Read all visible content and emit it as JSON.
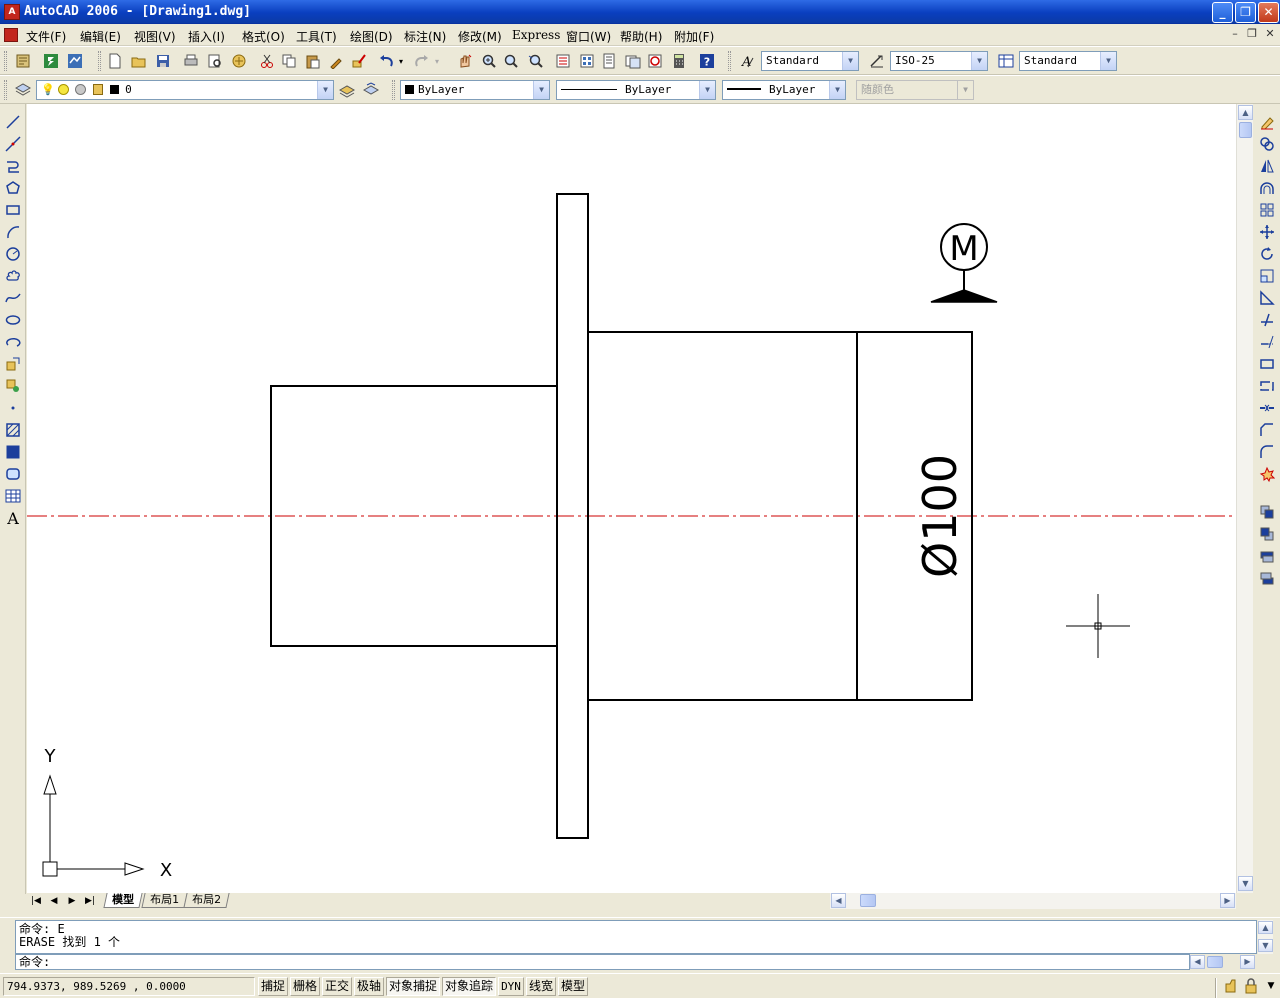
{
  "window": {
    "title": "AutoCAD 2006 - [Drawing1.dwg]",
    "minimize": "_",
    "maximize": "❐",
    "close": "✕"
  },
  "menubar": {
    "items": [
      "文件(F)",
      "编辑(E)",
      "视图(V)",
      "插入(I)",
      "格式(O)",
      "工具(T)",
      "绘图(D)",
      "标注(N)",
      "修改(M)",
      "Express",
      "窗口(W)",
      "帮助(H)",
      "附加(F)"
    ],
    "mdi_min": "–",
    "mdi_restore": "❐",
    "mdi_close": "✕"
  },
  "standard_toolbar": {
    "text_style": "Standard",
    "dim_style": "ISO-25",
    "table_style": "Standard"
  },
  "layers_toolbar": {
    "current_layer": "0",
    "color": "ByLayer",
    "linetype": "ByLayer",
    "lineweight": "ByLayer",
    "plot_style": "随颜色"
  },
  "drawing": {
    "dimension_text": "Ø100",
    "symbol_letter": "M",
    "ucs_x_label": "X",
    "ucs_y_label": "Y",
    "colors": {
      "geometry": "#000000",
      "centerline": "#CC0000",
      "background": "#FFFFFF"
    }
  },
  "tabs": {
    "items": [
      "模型",
      "布局1",
      "布局2"
    ],
    "active": "模型"
  },
  "command": {
    "history": [
      "命令: E",
      "ERASE 找到 1 个"
    ],
    "prompt": "命令:"
  },
  "status": {
    "coordinates": "794.9373, 989.5269 , 0.0000",
    "buttons": [
      {
        "label": "捕捉",
        "on": false
      },
      {
        "label": "栅格",
        "on": false
      },
      {
        "label": "正交",
        "on": false
      },
      {
        "label": "极轴",
        "on": false
      },
      {
        "label": "对象捕捉",
        "on": true
      },
      {
        "label": "对象追踪",
        "on": true
      },
      {
        "label": "DYN",
        "on": false
      },
      {
        "label": "线宽",
        "on": false
      },
      {
        "label": "模型",
        "on": false
      }
    ]
  }
}
